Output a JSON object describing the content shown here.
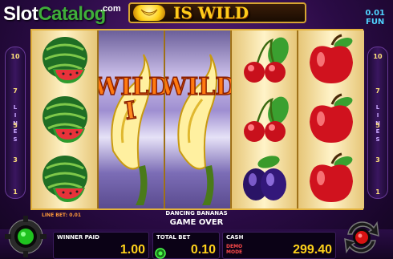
{
  "header": {
    "logo_slot": "Slot",
    "logo_catalog": "Catalog",
    "logo_com": ".com",
    "banner_text": "IS WILD",
    "fun_amount": "0.01",
    "fun_label": "FUN"
  },
  "side_lines": {
    "numbers_top_to_bottom": [
      "10",
      "7",
      "5",
      "3",
      "1"
    ],
    "label": [
      "L",
      "I",
      "N",
      "E",
      "S"
    ]
  },
  "reels": [
    [
      "watermelon-icon",
      "watermelon-icon",
      "watermelon-icon"
    ],
    [
      "wild-banana-icon"
    ],
    [
      "wild-banana-icon"
    ],
    [
      "cherry-icon",
      "cherry-icon",
      "plum-icon"
    ],
    [
      "apple-icon",
      "apple-icon",
      "apple-icon"
    ]
  ],
  "wild_text": "WILD",
  "status": {
    "line_bet": "LINE BET: 0.01",
    "game_title": "DANCING BANANAS",
    "game_state": "GAME OVER"
  },
  "panel": {
    "winner_paid_label": "WINNER PAID",
    "winner_paid_value": "1.00",
    "total_bet_label": "TOTAL BET",
    "total_bet_value": "0.10",
    "cash_label": "CASH",
    "cash_value": "299.40",
    "demo_mode": "DEMO\nMODE"
  },
  "colors": {
    "accent_gold": "#ffd21a",
    "frame_gold": "#e3b23c",
    "background_purple": "#2a0b45"
  }
}
